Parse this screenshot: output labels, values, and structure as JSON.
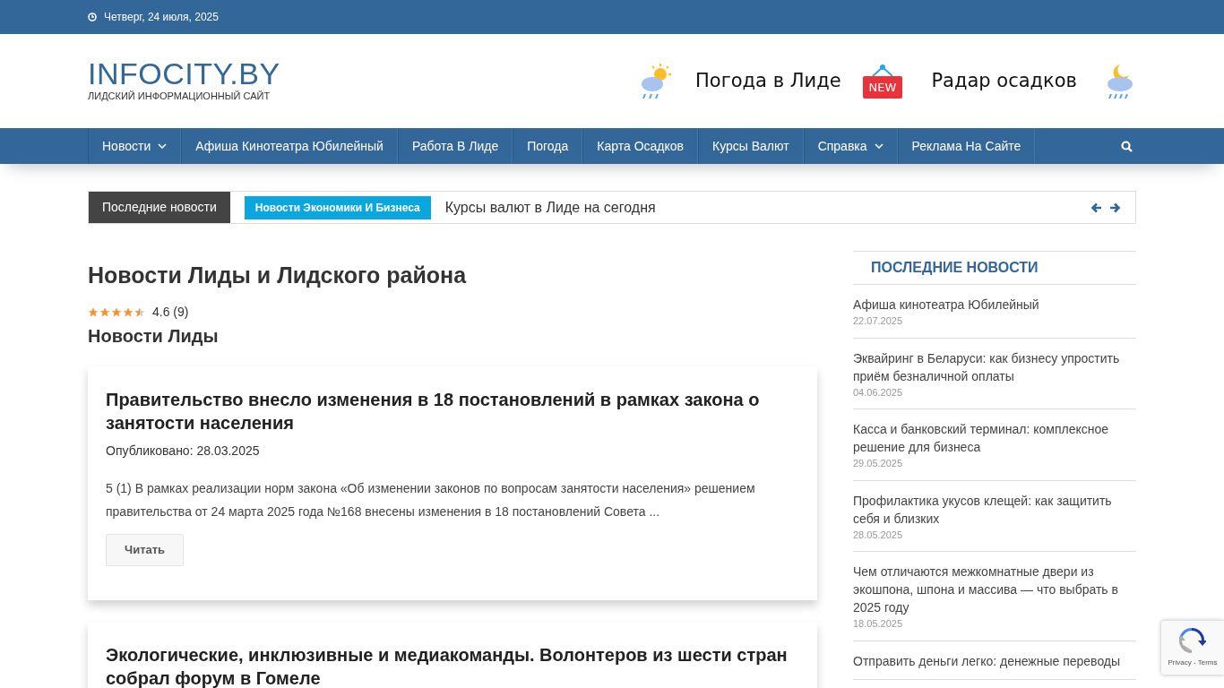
{
  "topbar": {
    "date": "Четверг, 24 июля, 2025"
  },
  "logo": {
    "title": "INFOCITY.BY",
    "tagline": "ЛИДСКИЙ ИНФОРМАЦИОННЫЙ САЙТ"
  },
  "header_links": [
    {
      "label": "Погода в Лиде",
      "kind": "weather"
    },
    {
      "label": "NEW",
      "kind": "badge"
    },
    {
      "label": "Радар осадков",
      "kind": "radar"
    }
  ],
  "nav": [
    {
      "label": "Новости",
      "dropdown": true
    },
    {
      "label": "Афиша Кинотеатра Юбилейный",
      "dropdown": false
    },
    {
      "label": "Работа В Лиде",
      "dropdown": false
    },
    {
      "label": "Погода",
      "dropdown": false
    },
    {
      "label": "Карта Осадков",
      "dropdown": false
    },
    {
      "label": "Курсы Валют",
      "dropdown": false
    },
    {
      "label": "Справка",
      "dropdown": true
    },
    {
      "label": "Реклама На Сайте",
      "dropdown": false
    }
  ],
  "ticker": {
    "title": "Последние новости",
    "category": "Новости Экономики И Бизнеса",
    "headline": "Курсы валют в Лиде на сегодня"
  },
  "page": {
    "title": "Новости Лиды и Лидского района",
    "stars": 4.5,
    "rating": "4.6 (9)",
    "subtitle": "Новости Лиды"
  },
  "articles": [
    {
      "title": "Правительство внесло изменения в 18 постановлений в рамках закона о занятости населения",
      "published": "Опубликовано: 28.03.2025",
      "excerpt": "5 (1) В рамках реализации норм закона «Об изменении законов по вопросам занятости населения» решением правительства от 24 марта 2025 года №168 внесены изменения в 18 постановлений Совета ...",
      "button": "Читать"
    },
    {
      "title": "Экологические, инклюзивные и медиакоманды. Волонтеров из шести стран собрал форум в Гомеле"
    }
  ],
  "sidebar": {
    "title": "ПОСЛЕДНИЕ НОВОСТИ",
    "items": [
      {
        "title": "Афиша кинотеатра Юбилейный",
        "date": "22.07.2025"
      },
      {
        "title": "Эквайринг в Беларуси: как бизнесу упростить приём безналичной оплаты",
        "date": "04.06.2025"
      },
      {
        "title": "Касса и банковский терминал: комплексное решение для бизнеса",
        "date": "29.05.2025"
      },
      {
        "title": "Профилактика укусов клещей: как защитить себя и близких",
        "date": "28.05.2025"
      },
      {
        "title": "Чем отличаются межкомнатные двери из экошпона, шпона и массива — что выбрать в 2025 году",
        "date": "18.05.2025"
      },
      {
        "title": "Отправить деньги легко: денежные переводы"
      }
    ]
  },
  "recaptcha": {
    "links": "Privacy - Terms"
  }
}
